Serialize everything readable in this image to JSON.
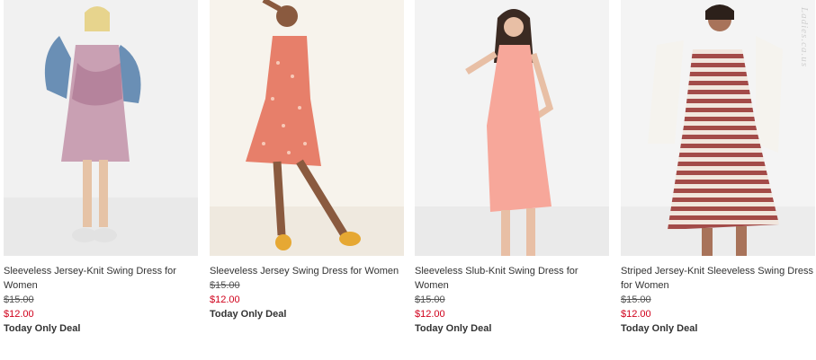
{
  "products": [
    {
      "name": "Sleeveless Jersey-Knit Swing Dress for Women",
      "old_price": "$15.00",
      "new_price": "$12.00",
      "deal": "Today Only Deal"
    },
    {
      "name": "Sleeveless Jersey Swing Dress for Women",
      "old_price": "$15.00",
      "new_price": "$12.00",
      "deal": "Today Only Deal"
    },
    {
      "name": "Sleeveless Slub-Knit Swing Dress for Women",
      "old_price": "$15.00",
      "new_price": "$12.00",
      "deal": "Today Only Deal"
    },
    {
      "name": "Striped Jersey-Knit Sleeveless Swing Dress for Women",
      "old_price": "$15.00",
      "new_price": "$12.00",
      "deal": "Today Only Deal"
    }
  ],
  "watermark": "Ladies.ca.us",
  "colors": {
    "sale_price": "#d0001b",
    "dress_1": "#c9a0b3",
    "dress_2": "#e77f6a",
    "dress_3": "#f7a79a",
    "dress_4": "#a34b48"
  }
}
